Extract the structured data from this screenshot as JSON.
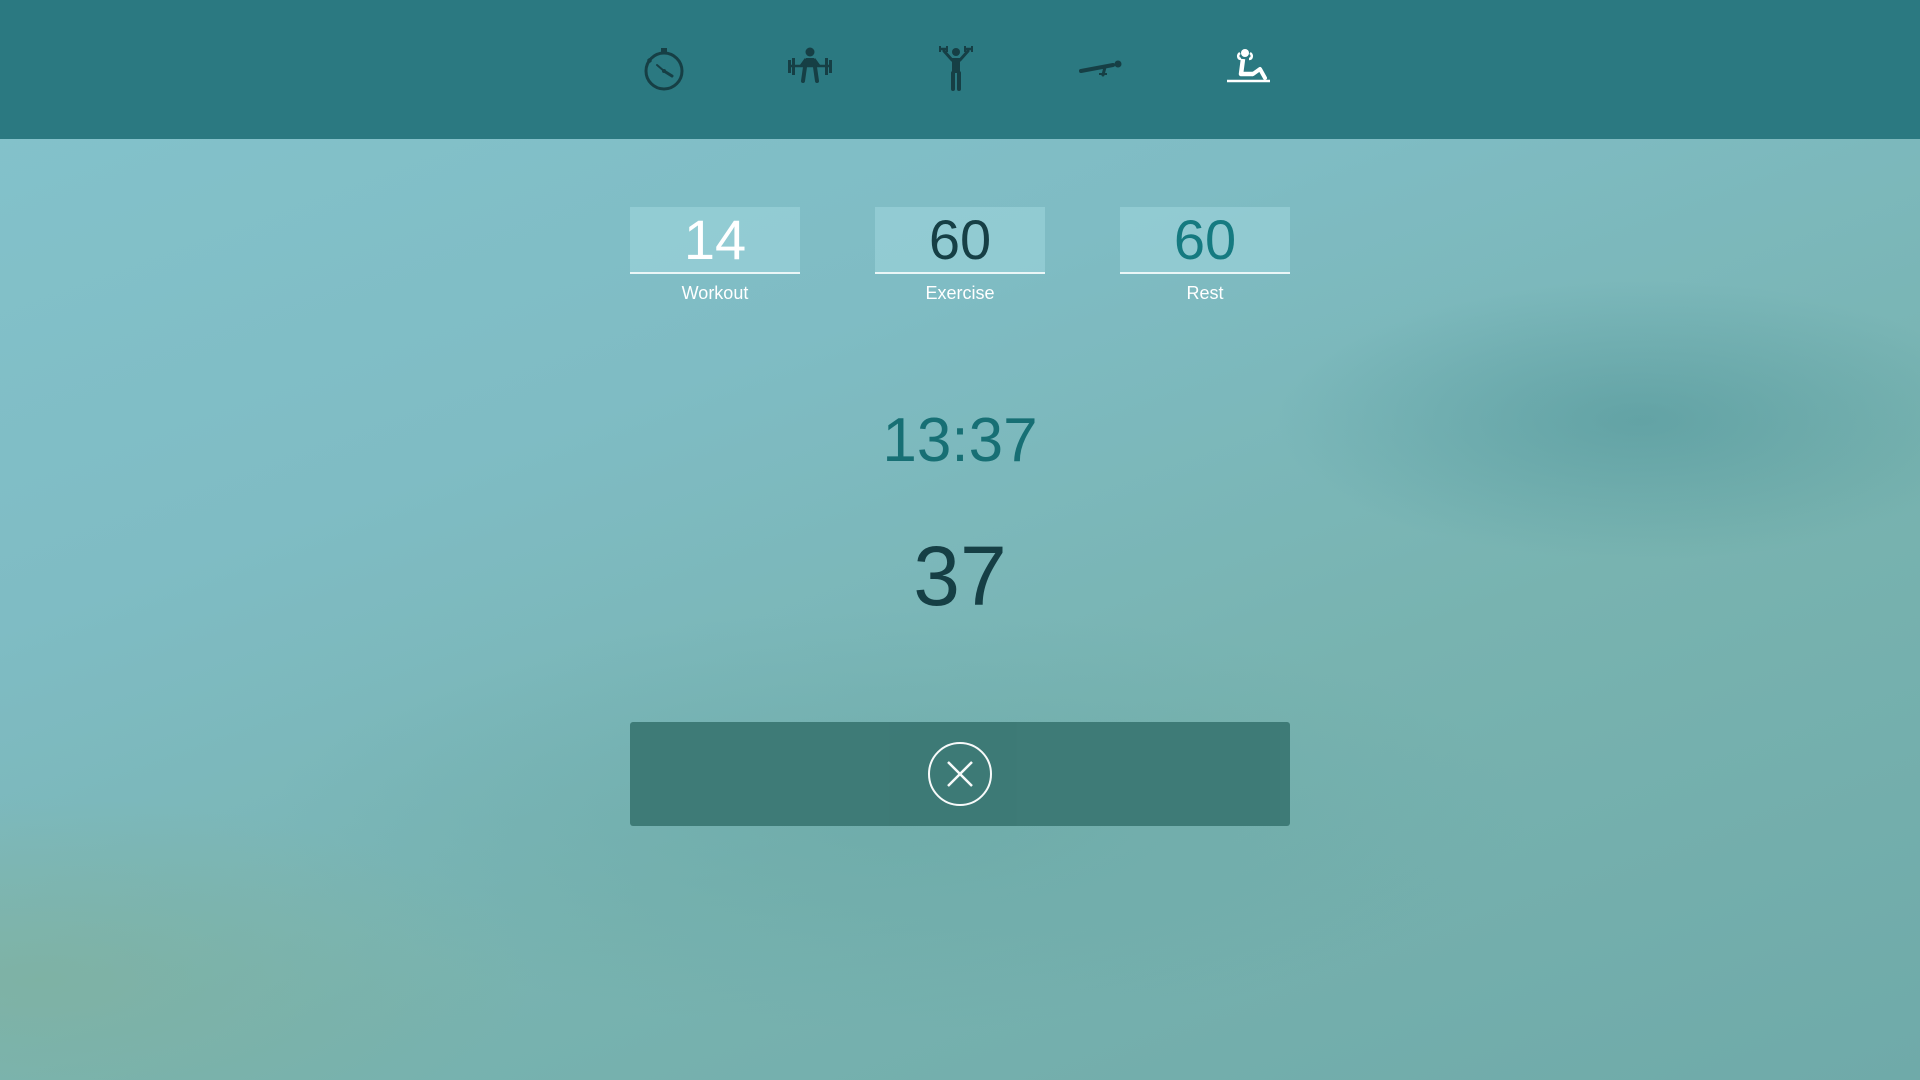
{
  "nav": {
    "icons": [
      "stopwatch-icon",
      "weightlifting-icon",
      "dumbbell-raise-icon",
      "plank-icon",
      "situp-icon"
    ],
    "active_index": 4,
    "colors": {
      "inactive": "#163f45",
      "active": "#ffffff"
    }
  },
  "settings": {
    "workout": {
      "value": "14",
      "label": "Workout"
    },
    "exercise": {
      "value": "60",
      "label": "Exercise"
    },
    "rest": {
      "value": "60",
      "label": "Rest"
    }
  },
  "timer": {
    "total": "13:37",
    "countdown": "37"
  },
  "controls": {
    "stop_icon": "close-circle-icon"
  },
  "colors": {
    "topbar": "#2b7981",
    "accent": "#176f74",
    "dark": "#163f45",
    "button": "#3b7874"
  }
}
